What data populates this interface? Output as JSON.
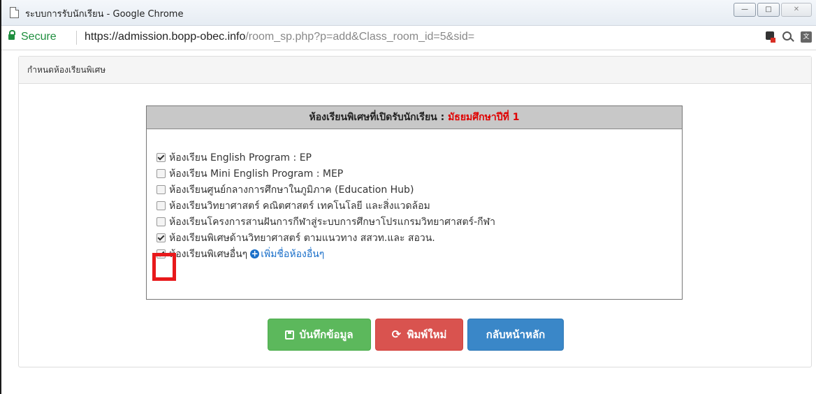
{
  "window": {
    "title": "ระบบการรับนักเรียน - Google Chrome",
    "controls": [
      "—",
      "□",
      "✕"
    ]
  },
  "address_bar": {
    "secure_label": "Secure",
    "url_host": "https://admission.bopp-obec.info",
    "url_path": "/room_sp.php?p=add&Class_room_id=5&sid="
  },
  "panel": {
    "heading": "กำหนดห้องเรียนพิเศษ"
  },
  "rooms": {
    "header_text": "ห้องเรียนพิเศษที่เปิดรับนักเรียน : ",
    "header_level": "มัธยมศึกษาปีที่ 1",
    "options": [
      {
        "label": "ห้องเรียน English Program : EP",
        "checked": true
      },
      {
        "label": "ห้องเรียน Mini English Program : MEP",
        "checked": false
      },
      {
        "label": "ห้องเรียนศูนย์กลางการศึกษาในภูมิภาค (Education Hub)",
        "checked": false
      },
      {
        "label": "ห้องเรียนวิทยาศาสตร์ คณิตศาสตร์ เทคโนโลยี และสิ่งแวดล้อม",
        "checked": false
      },
      {
        "label": "ห้องเรียนโครงการสานฝันการกีฬาสู่ระบบการศึกษาโปรแกรมวิทยาศาสตร์-กีฬา",
        "checked": false
      },
      {
        "label": "ห้องเรียนพิเศษด้านวิทยาศาสตร์ ตามแนวทาง สสวท.และ สอวน.",
        "checked": true
      },
      {
        "label": "ห้องเรียนพิเศษอื่นๆ",
        "checked": true
      }
    ],
    "add_other_label": "เพิ่มชื่อห้องอื่นๆ"
  },
  "buttons": {
    "save": "บันทึกข้อมูล",
    "reset": "พิมพ์ใหม่",
    "home": "กลับหน้าหลัก"
  },
  "colors": {
    "secure_green": "#1e8e3e",
    "level_red": "#e00000",
    "save_green": "#5cb85c",
    "reset_red": "#d9534f",
    "home_blue": "#3a87c8",
    "highlight_red": "#e8191b"
  }
}
